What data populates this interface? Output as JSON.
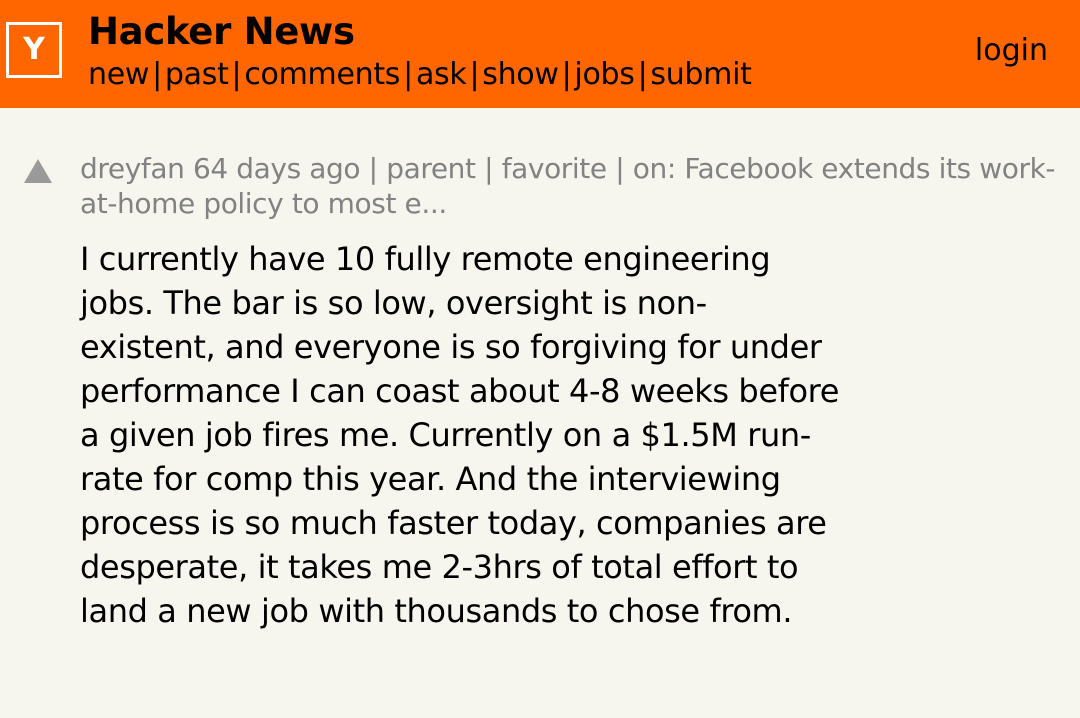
{
  "header": {
    "logo_letter": "Y",
    "title": "Hacker News",
    "nav": [
      "new",
      "past",
      "comments",
      "ask",
      "show",
      "jobs",
      "submit"
    ],
    "separator": "|",
    "login": "login",
    "colors": {
      "bar": "#ff6600",
      "logo_border": "#ffffff"
    }
  },
  "comment": {
    "vote_icon": "upvote-arrow-icon",
    "user": "dreyfan",
    "age": "64 days ago",
    "parent_link": "parent",
    "favorite_link": "favorite",
    "on_label": "on:",
    "story_title": "Facebook extends its work-at-home policy to most e...",
    "text": "I currently have 10 fully remote engineering jobs. The bar is so low, oversight is non-existent, and everyone is so forgiving for under performance I can coast about 4-8 weeks before a given job fires me. Currently on a $1.5M run-rate for comp this year. And the interviewing process is so much faster today, companies are desperate, it takes me 2-3hrs of total effort to land a new job with thousands to chose from."
  },
  "colors": {
    "background": "#f6f6ef",
    "meta_text": "#828282",
    "body_text": "#000000"
  }
}
